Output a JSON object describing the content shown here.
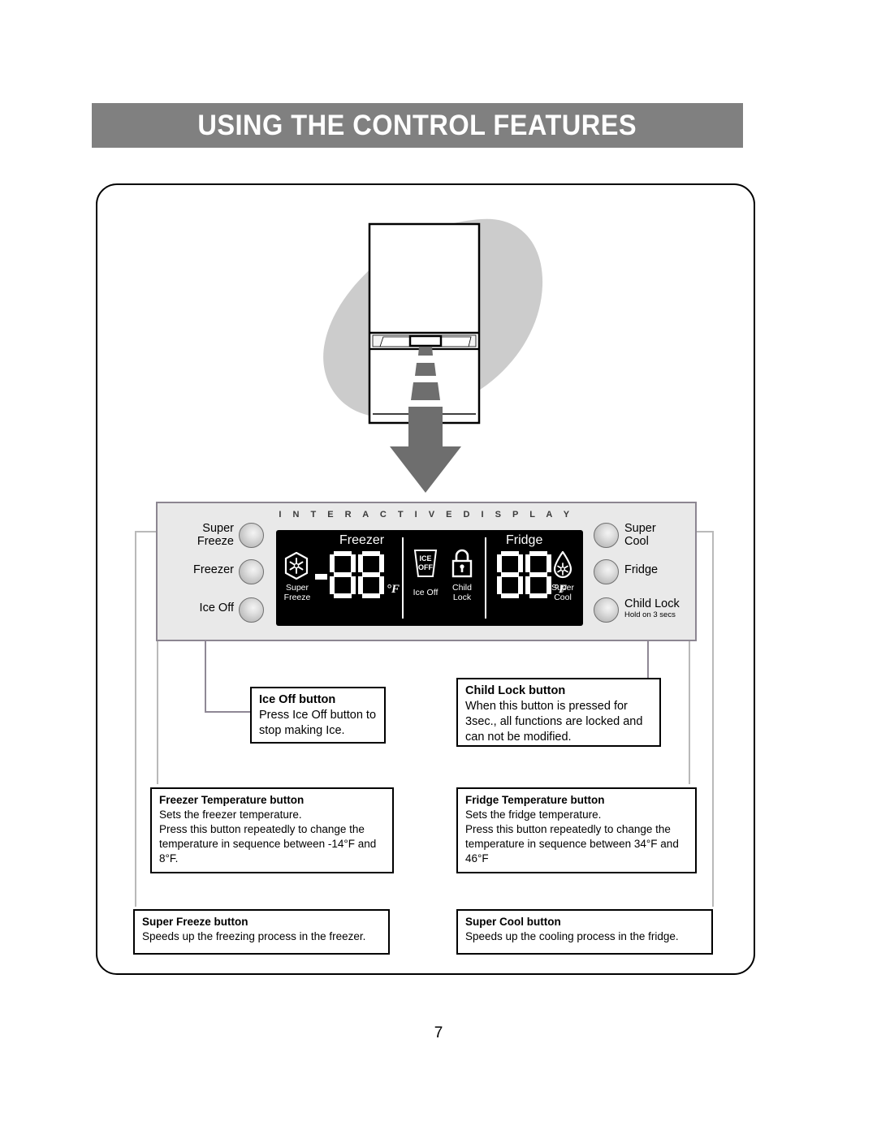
{
  "header": {
    "title": "USING THE CONTROL FEATURES"
  },
  "panel": {
    "display_header": "I N T E R A C T I V E   D I S P L A Y",
    "lcd": {
      "freezer_title": "Freezer",
      "fridge_title": "Fridge",
      "freezer_value": "-88",
      "freezer_unit": "°F",
      "fridge_value": "88",
      "fridge_unit": "°F",
      "super_freeze_label": "Super\nFreeze",
      "super_freeze_line1": "Super",
      "super_freeze_line2": "Freeze",
      "ice_off_label": "Ice Off",
      "ice_off_icon_line1": "ICE",
      "ice_off_icon_line2": "OFF",
      "child_lock_line1": "Child",
      "child_lock_line2": "Lock",
      "super_cool_line1": "Super",
      "super_cool_line2": "Cool"
    },
    "left_buttons": [
      {
        "line1": "Super",
        "line2": "Freeze"
      },
      {
        "line1": "Freezer",
        "line2": ""
      },
      {
        "line1": "Ice Off",
        "line2": ""
      }
    ],
    "right_buttons": [
      {
        "line1": "Super",
        "line2": "Cool",
        "sub": ""
      },
      {
        "line1": "Fridge",
        "line2": "",
        "sub": ""
      },
      {
        "line1": "Child Lock",
        "line2": "",
        "sub": "Hold on 3 secs"
      }
    ]
  },
  "callouts": {
    "ice_off": {
      "title": "Ice Off button",
      "body": "Press Ice Off button to stop making Ice."
    },
    "child_lock": {
      "title": "Child Lock button",
      "body": "When this button is pressed for 3sec., all functions are locked and can not be modified."
    },
    "freezer_temp": {
      "title": "Freezer Temperature button",
      "body": "Sets the freezer temperature.\nPress this button repeatedly to change the temperature in sequence between -14°F and 8°F."
    },
    "fridge_temp": {
      "title": "Fridge Temperature button",
      "body": "Sets the fridge temperature.\nPress this button repeatedly to change the temperature in sequence between 34°F and 46°F"
    },
    "super_freeze": {
      "title": "Super Freeze button",
      "body": "Speeds up the freezing process in the freezer."
    },
    "super_cool": {
      "title": "Super Cool button",
      "body": "Speeds up the cooling process in the fridge."
    }
  },
  "footer": {
    "page_number": "7"
  },
  "colors": {
    "banner_background": "#808080",
    "banner_text": "#ffffff",
    "panel_background": "#e9e9e9",
    "panel_border": "#8c8691",
    "lcd_background": "#000000",
    "lcd_text": "#ffffff",
    "illustration_blob": "#cccccc",
    "arrow": "#6e6e6e",
    "leader_line": "#9b93a0"
  }
}
